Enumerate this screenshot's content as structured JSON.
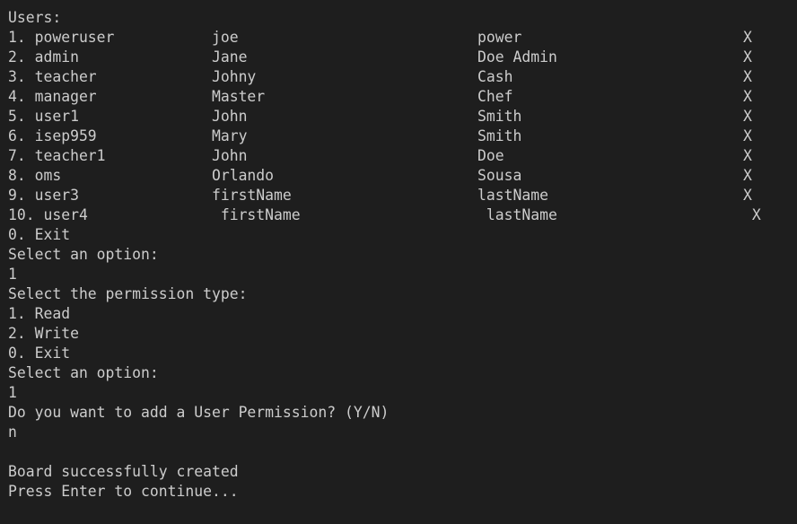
{
  "terminal": {
    "lines": [
      "Users:",
      "1. poweruser           joe                           power                         X",
      "2. admin               Jane                          Doe Admin                     X",
      "3. teacher             Johny                         Cash                          X",
      "4. manager             Master                        Chef                          X",
      "5. user1               John                          Smith                         X",
      "6. isep959             Mary                          Smith                         X",
      "7. teacher1            John                          Doe                           X",
      "8. oms                 Orlando                       Sousa                         X",
      "9. user3               firstName                     lastName                      X",
      "10. user4               firstName                     lastName                      X",
      "0. Exit",
      "Select an option:",
      "1",
      "Select the permission type:",
      "1. Read",
      "2. Write",
      "0. Exit",
      "Select an option:",
      "1",
      "Do you want to add a User Permission? (Y/N)",
      "n",
      "",
      "Board successfully created",
      "Press Enter to continue..."
    ]
  }
}
